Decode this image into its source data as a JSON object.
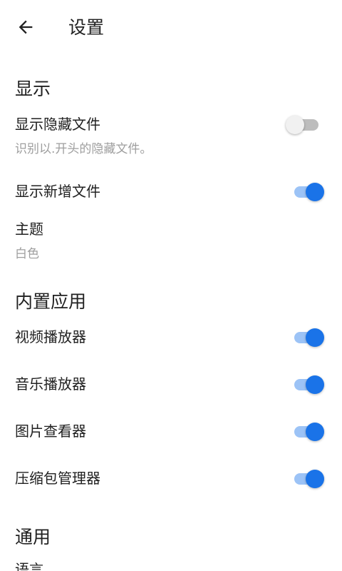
{
  "appbar": {
    "back_icon": "arrow-left-icon",
    "title": "设置"
  },
  "sections": {
    "display": {
      "header": "显示",
      "show_hidden": {
        "title": "显示隐藏文件",
        "subtitle": "识别以.开头的隐藏文件。",
        "enabled": false
      },
      "show_new": {
        "title": "显示新增文件",
        "enabled": true
      },
      "theme": {
        "title": "主题",
        "value": "白色"
      }
    },
    "builtin": {
      "header": "内置应用",
      "video_player": {
        "title": "视频播放器",
        "enabled": true
      },
      "music_player": {
        "title": "音乐播放器",
        "enabled": true
      },
      "image_viewer": {
        "title": "图片查看器",
        "enabled": true
      },
      "archive_manager": {
        "title": "压缩包管理器",
        "enabled": true
      }
    },
    "general": {
      "header": "通用",
      "language": {
        "title": "语言"
      }
    }
  },
  "colors": {
    "accent": "#1a73e8",
    "accent_track": "#9cc3f6",
    "off_thumb": "#f1f1f1",
    "off_track": "#bdbdbd",
    "subtitle": "#9e9e9e",
    "text": "#212121"
  }
}
